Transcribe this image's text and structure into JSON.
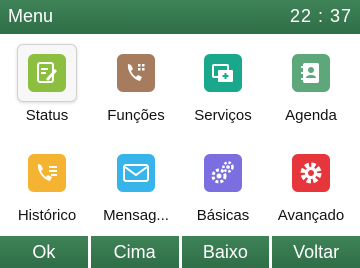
{
  "header": {
    "title": "Menu",
    "time": "22 : 37"
  },
  "apps": [
    {
      "label": "Status",
      "icon": "status-edit-icon",
      "color": "#8cbf3f",
      "selected": true
    },
    {
      "label": "Funções",
      "icon": "phone-features-icon",
      "color": "#a77c5e"
    },
    {
      "label": "Serviços",
      "icon": "services-folder-icon",
      "color": "#1aa88d"
    },
    {
      "label": "Agenda",
      "icon": "contacts-book-icon",
      "color": "#5ea77b"
    },
    {
      "label": "Histórico",
      "icon": "call-history-icon",
      "color": "#f4b431"
    },
    {
      "label": "Mensag...",
      "icon": "message-envelope-icon",
      "color": "#37b5ea"
    },
    {
      "label": "Básicas",
      "icon": "basic-settings-gears-icon",
      "color": "#7a6ee0"
    },
    {
      "label": "Avançado",
      "icon": "advanced-settings-gear-icon",
      "color": "#e6353b"
    }
  ],
  "softkeys": [
    "Ok",
    "Cima",
    "Baixo",
    "Voltar"
  ]
}
